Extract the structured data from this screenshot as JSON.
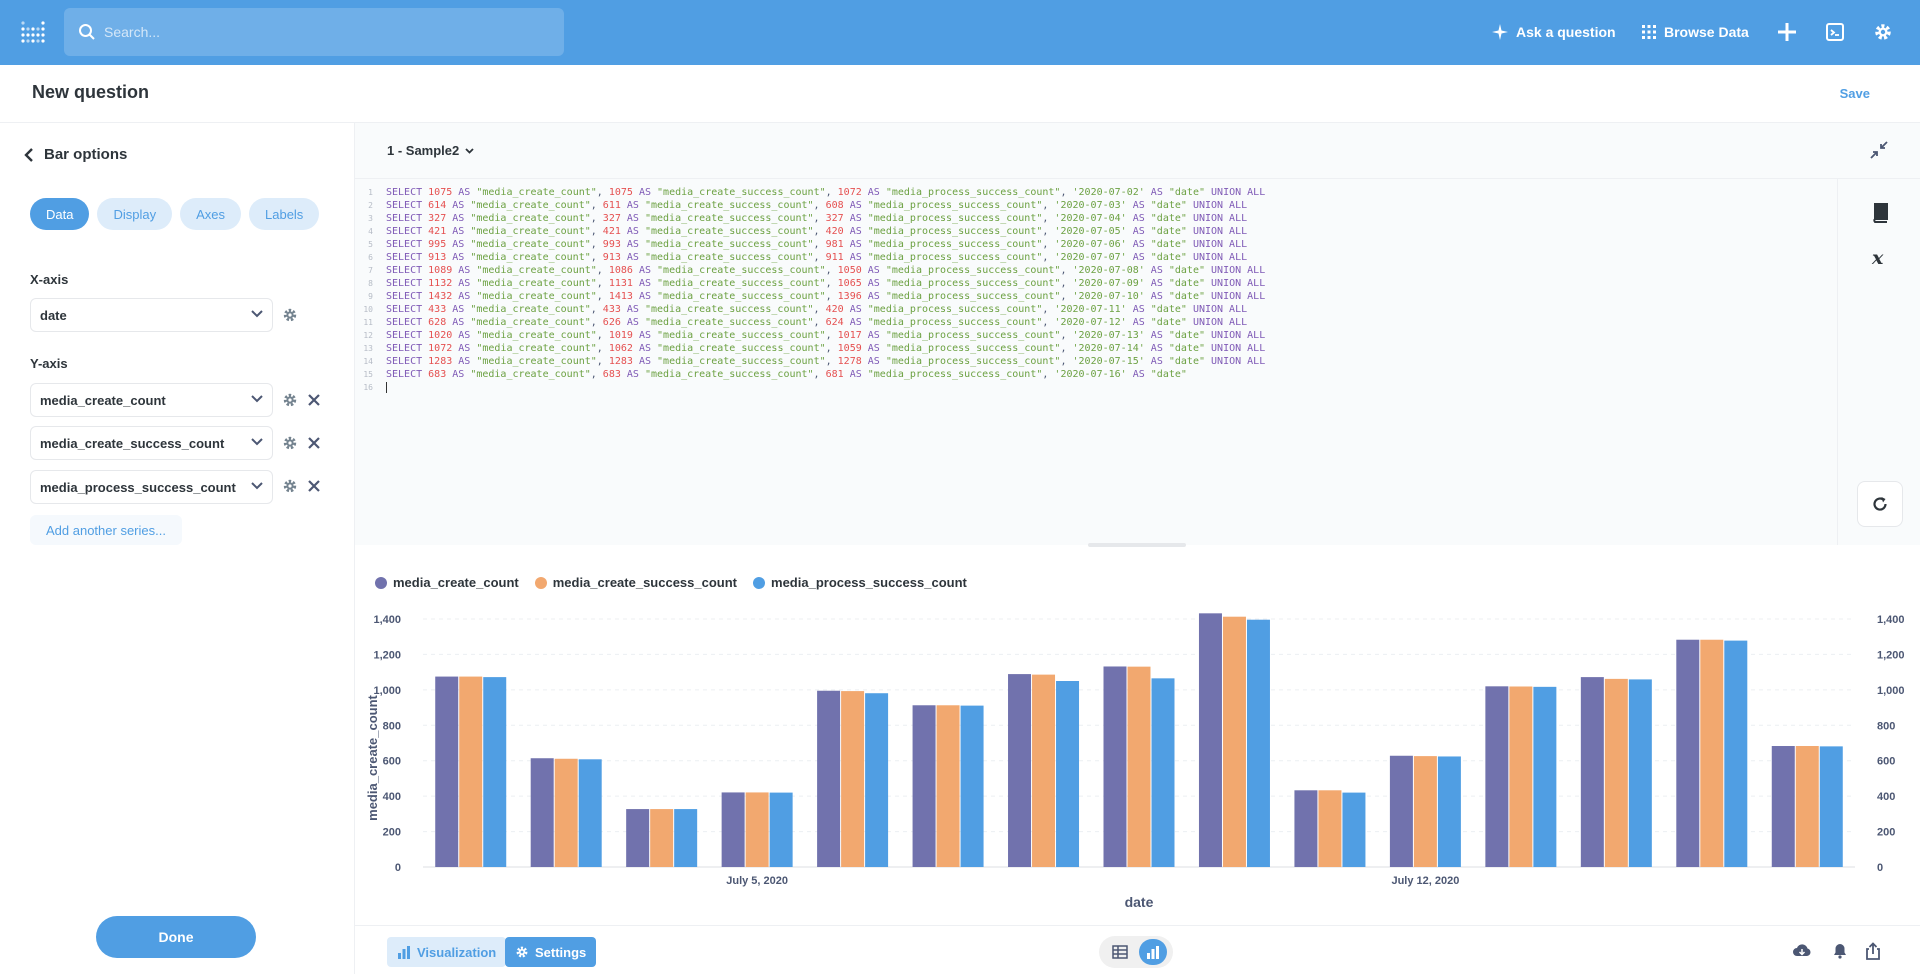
{
  "nav": {
    "search_placeholder": "Search...",
    "ask_question": "Ask a question",
    "browse_data": "Browse Data"
  },
  "header": {
    "title": "New question",
    "save": "Save"
  },
  "sidebar": {
    "back_label": "Bar options",
    "tabs": [
      "Data",
      "Display",
      "Axes",
      "Labels"
    ],
    "active_tab": "Data",
    "x_axis_label": "X-axis",
    "x_axis_value": "date",
    "y_axis_label": "Y-axis",
    "y_axis_values": [
      "media_create_count",
      "media_create_success_count",
      "media_process_success_count"
    ],
    "add_series": "Add another series...",
    "done": "Done"
  },
  "editor": {
    "database": "1 - Sample2",
    "line_numbers": [
      "1",
      "2",
      "3",
      "4",
      "5",
      "6",
      "7",
      "8",
      "9",
      "10",
      "11",
      "12",
      "13",
      "14",
      "15",
      "16"
    ],
    "rows": [
      {
        "a": "1075",
        "b": "1075",
        "c": "1072",
        "d": "'2020-07-02'",
        "tail": "UNION ALL"
      },
      {
        "a": "614",
        "b": "611",
        "c": "608",
        "d": "'2020-07-03'",
        "tail": "UNION ALL"
      },
      {
        "a": "327",
        "b": "327",
        "c": "327",
        "d": "'2020-07-04'",
        "tail": "UNION ALL"
      },
      {
        "a": "421",
        "b": "421",
        "c": "420",
        "d": "'2020-07-05'",
        "tail": "UNION ALL"
      },
      {
        "a": "995",
        "b": "993",
        "c": "981",
        "d": "'2020-07-06'",
        "tail": "UNION ALL"
      },
      {
        "a": "913",
        "b": "913",
        "c": "911",
        "d": "'2020-07-07'",
        "tail": "UNION ALL"
      },
      {
        "a": "1089",
        "b": "1086",
        "c": "1050",
        "d": "'2020-07-08'",
        "tail": "UNION ALL"
      },
      {
        "a": "1132",
        "b": "1131",
        "c": "1065",
        "d": "'2020-07-09'",
        "tail": "UNION ALL"
      },
      {
        "a": "1432",
        "b": "1413",
        "c": "1396",
        "d": "'2020-07-10'",
        "tail": "UNION ALL"
      },
      {
        "a": "433",
        "b": "433",
        "c": "420",
        "d": "'2020-07-11'",
        "tail": "UNION ALL"
      },
      {
        "a": "628",
        "b": "626",
        "c": "624",
        "d": "'2020-07-12'",
        "tail": "UNION ALL"
      },
      {
        "a": "1020",
        "b": "1019",
        "c": "1017",
        "d": "'2020-07-13'",
        "tail": "UNION ALL"
      },
      {
        "a": "1072",
        "b": "1062",
        "c": "1059",
        "d": "'2020-07-14'",
        "tail": "UNION ALL"
      },
      {
        "a": "1283",
        "b": "1283",
        "c": "1278",
        "d": "'2020-07-15'",
        "tail": "UNION ALL"
      },
      {
        "a": "683",
        "b": "683",
        "c": "681",
        "d": "'2020-07-16'",
        "tail": ""
      }
    ],
    "sql_tokens": {
      "select": "SELECT",
      "as": "AS",
      "col_a": "\"media_create_count\"",
      "col_b": "\"media_create_success_count\"",
      "col_c": "\"media_process_success_count\"",
      "col_d": "\"date\""
    }
  },
  "footer": {
    "visualization": "Visualization",
    "settings": "Settings"
  },
  "colors": {
    "accent": "#509ee3",
    "series": [
      "#7172ad",
      "#f2a86f",
      "#509ee3"
    ]
  },
  "chart_data": {
    "type": "bar",
    "categories": [
      "2020-07-02",
      "2020-07-03",
      "2020-07-04",
      "2020-07-05",
      "2020-07-06",
      "2020-07-07",
      "2020-07-08",
      "2020-07-09",
      "2020-07-10",
      "2020-07-11",
      "2020-07-12",
      "2020-07-13",
      "2020-07-14",
      "2020-07-15",
      "2020-07-16"
    ],
    "series": [
      {
        "name": "media_create_count",
        "values": [
          1075,
          614,
          327,
          421,
          995,
          913,
          1089,
          1132,
          1432,
          433,
          628,
          1020,
          1072,
          1283,
          683
        ]
      },
      {
        "name": "media_create_success_count",
        "values": [
          1075,
          611,
          327,
          421,
          993,
          913,
          1086,
          1131,
          1413,
          433,
          626,
          1019,
          1062,
          1283,
          683
        ]
      },
      {
        "name": "media_process_success_count",
        "values": [
          1072,
          608,
          327,
          420,
          981,
          911,
          1050,
          1065,
          1396,
          420,
          624,
          1017,
          1059,
          1278,
          681
        ]
      }
    ],
    "xlabel": "date",
    "ylabel": "media_create_count",
    "ylim": [
      0,
      1400
    ],
    "y_ticks": [
      "0",
      "200",
      "400",
      "600",
      "800",
      "1,000",
      "1,200",
      "1,400"
    ],
    "x_tick_labels": [
      {
        "label": "July 5, 2020",
        "category": "2020-07-05"
      },
      {
        "label": "July 12, 2020",
        "category": "2020-07-12"
      }
    ],
    "grid": true,
    "legend": "top-left"
  }
}
